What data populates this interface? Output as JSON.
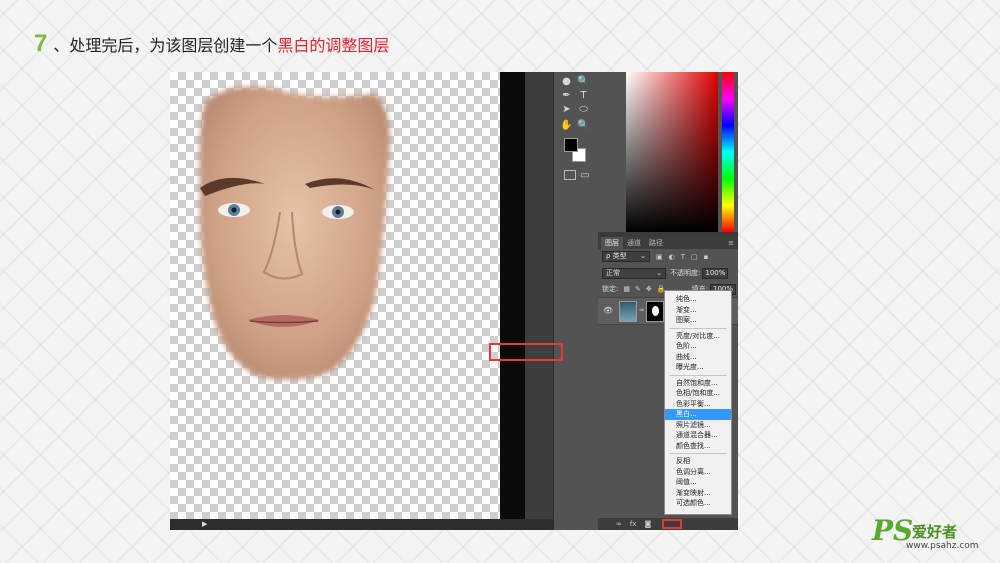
{
  "header": {
    "step_number": "7",
    "text": "、处理完后，为该图层创建一个",
    "highlight": "黑白的调整图层",
    "step_color": "#7cbb3a",
    "highlight_color": "#e8212a"
  },
  "photoshop": {
    "layers_panel": {
      "tabs": [
        "图层",
        "通道",
        "路径"
      ],
      "filter_label": "ρ 类型",
      "blend_mode": "正常",
      "opacity_label": "不透明度:",
      "opacity_value": "100%",
      "lock_label": "锁定:",
      "fill_label": "填充:",
      "fill_value": "100%"
    },
    "adjustment_menu": {
      "items": [
        "纯色...",
        "渐变...",
        "图案...",
        "亮度/对比度...",
        "色阶...",
        "曲线...",
        "曝光度...",
        "自然饱和度...",
        "色相/饱和度...",
        "色彩平衡...",
        "黑白...",
        "照片滤镜...",
        "通道混合器...",
        "颜色查找...",
        "反相",
        "色调分离...",
        "阈值...",
        "渐变映射...",
        "可选颜色..."
      ],
      "selected": "黑白..."
    },
    "toolbox_icons": [
      "drop-icon",
      "zoom-icon",
      "pen-icon",
      "type-icon",
      "path-select-icon",
      "ellipse-icon",
      "hand-icon",
      "zoom-tool-icon"
    ]
  },
  "watermark": {
    "brand": "PS",
    "name": "爱好者",
    "url": "www.psahz.com",
    "brand_color": "#5aa82d"
  }
}
